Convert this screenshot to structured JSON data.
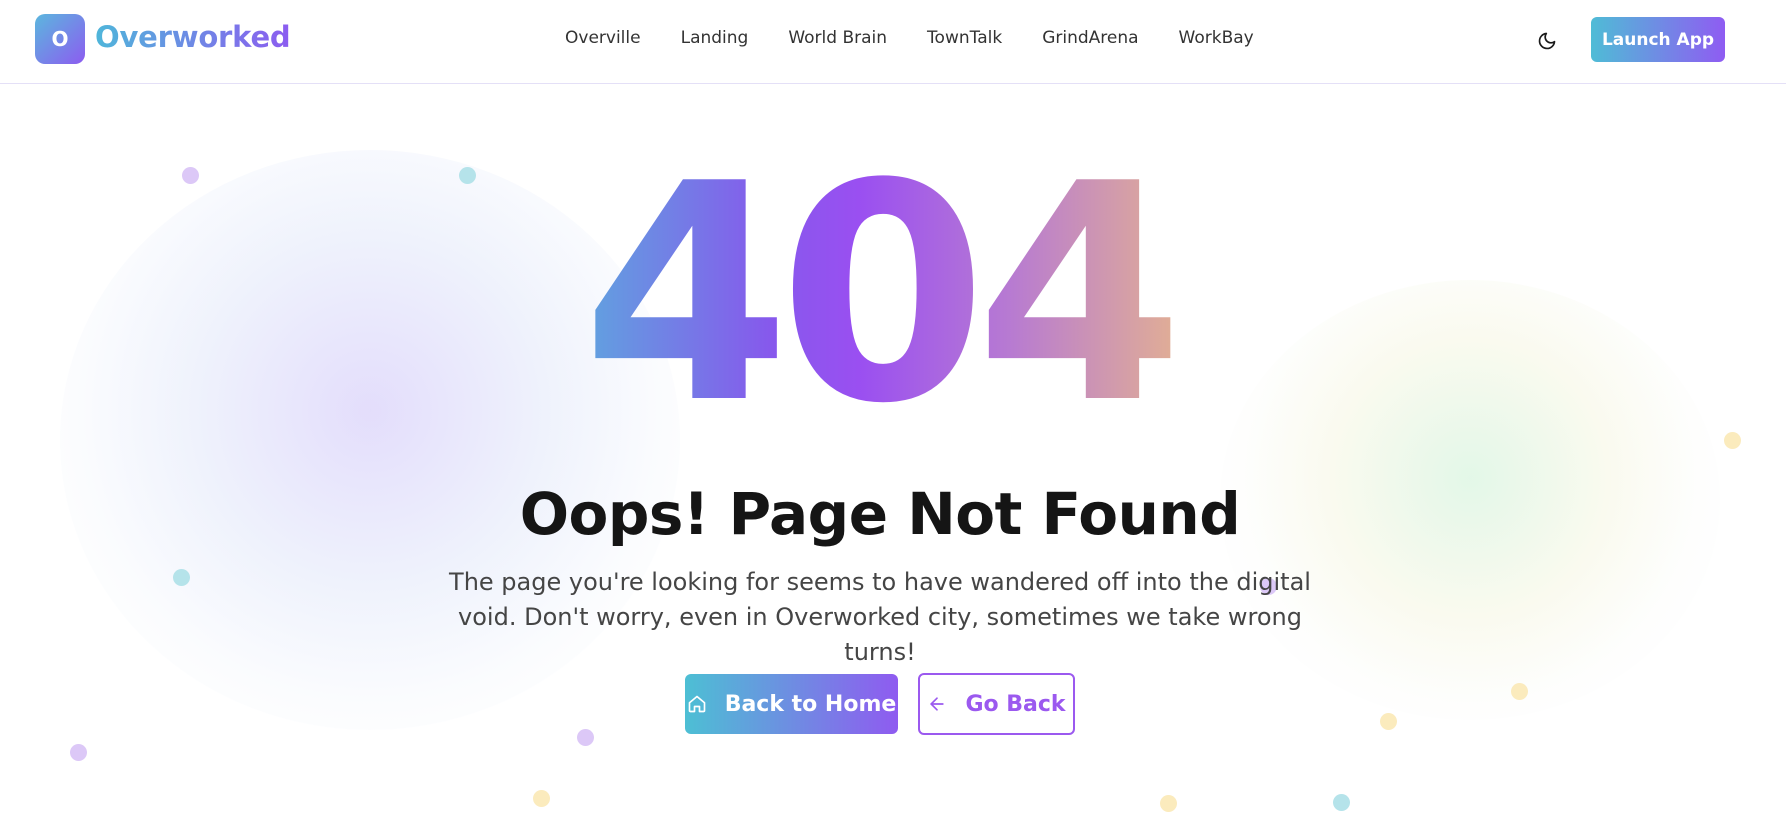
{
  "header": {
    "logo_letter": "O",
    "logo_text": "Overworked",
    "nav": [
      "Overville",
      "Landing",
      "World Brain",
      "TownTalk",
      "GrindArena",
      "WorkBay"
    ],
    "theme_icon": "moon-icon",
    "launch_label": "Launch App"
  },
  "main": {
    "code": "404",
    "title": "Oops! Page Not Found",
    "description": "The page you're looking for seems to have wandered off into the digital void. Don't worry, even in Overworked city, sometimes we take wrong turns!",
    "home_button": {
      "label": "Back to Home",
      "icon": "home-icon"
    },
    "back_button": {
      "label": "Go Back",
      "icon": "arrow-left-icon"
    }
  },
  "colors": {
    "brand_cyan": "#4fbcd6",
    "brand_purple": "#8f5cf2",
    "text_dark": "#151515",
    "text_muted": "#454545"
  }
}
